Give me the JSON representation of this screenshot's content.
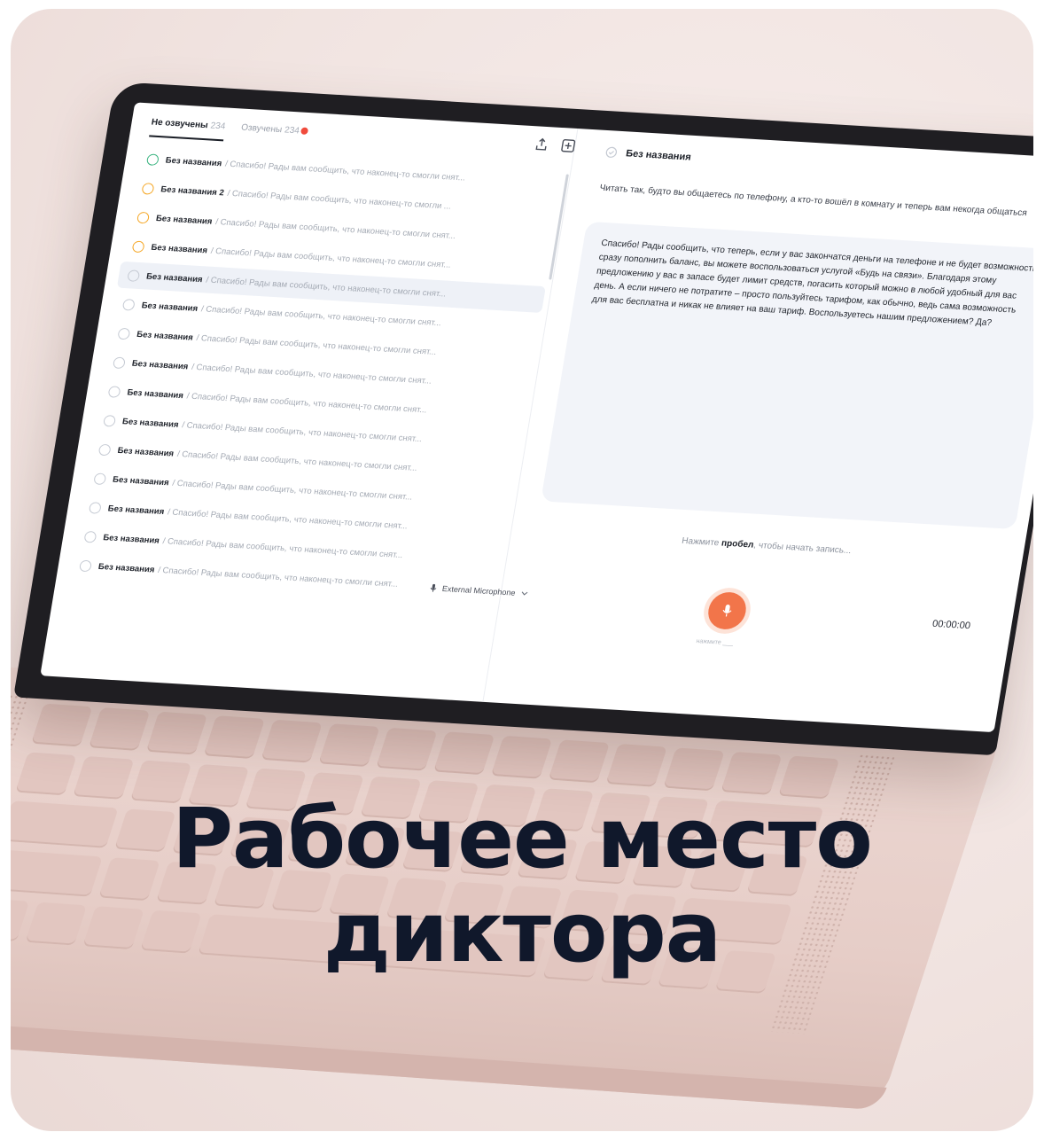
{
  "tabs": [
    {
      "label": "Не озвучены",
      "count": "234",
      "active": true
    },
    {
      "label": "Озвучены",
      "count": "234",
      "active": false
    }
  ],
  "toolbar": {
    "upload_icon": "upload-icon",
    "add_icon": "plus-square-icon"
  },
  "list": [
    {
      "title": "Без названия",
      "preview": "/ Спасибо! Рады вам сообщить, что наконец-то смогли снят...",
      "status": "done"
    },
    {
      "title": "Без названия 2",
      "preview": "/ Спасибо! Рады вам сообщить, что наконец-то смогли ...",
      "status": "wait"
    },
    {
      "title": "Без названия",
      "preview": "/ Спасибо! Рады вам сообщить, что наконец-то смогли снят...",
      "status": "wait"
    },
    {
      "title": "Без названия",
      "preview": "/ Спасибо! Рады вам сообщить, что наконец-то смогли снят...",
      "status": "wait"
    },
    {
      "title": "Без названия",
      "preview": "/ Спасибо! Рады вам сообщить, что наконец-то смогли снят...",
      "status": "none",
      "selected": true
    },
    {
      "title": "Без названия",
      "preview": "/ Спасибо! Рады вам сообщить, что наконец-то смогли снят...",
      "status": "none"
    },
    {
      "title": "Без названия",
      "preview": "/ Спасибо! Рады вам сообщить, что наконец-то смогли снят...",
      "status": "none"
    },
    {
      "title": "Без названия",
      "preview": "/ Спасибо! Рады вам сообщить, что наконец-то смогли снят...",
      "status": "none"
    },
    {
      "title": "Без названия",
      "preview": "/ Спасибо! Рады вам сообщить, что наконец-то смогли снят...",
      "status": "none"
    },
    {
      "title": "Без названия",
      "preview": "/ Спасибо! Рады вам сообщить, что наконец-то смогли снят...",
      "status": "none"
    },
    {
      "title": "Без названия",
      "preview": "/ Спасибо! Рады вам сообщить, что наконец-то смогли снят...",
      "status": "none"
    },
    {
      "title": "Без названия",
      "preview": "/ Спасибо! Рады вам сообщить, что наконец-то смогли снят...",
      "status": "none"
    },
    {
      "title": "Без названия",
      "preview": "/ Спасибо! Рады вам сообщить, что наконец-то смогли снят...",
      "status": "none"
    },
    {
      "title": "Без названия",
      "preview": "/ Спасибо! Рады вам сообщить, что наконец-то смогли снят...",
      "status": "none"
    },
    {
      "title": "Без названия",
      "preview": "/ Спасибо! Рады вам сообщить, что наконец-то смогли снят...",
      "status": "none"
    }
  ],
  "document": {
    "title": "Без названия",
    "instruction": "Читать так, будто вы общаетесь по телефону, а кто-то вошёл в комнату и теперь вам некогда общаться",
    "script": "Спасибо! Рады сообщить, что теперь, если у вас закончатся деньги на телефоне и не будет возможности сразу пополнить баланс, вы можете воспользоваться услугой «Будь на связи». Благодаря этому предложению у вас в запасе будет лимит средств, погасить который можно в любой удобный для вас день. А если ничего не потратите – просто пользуйтесь тарифом, как обычно, ведь сама возможность для вас бесплатна и никак не влияет на ваш тариф. Воспользуетесь нашим предложением? Да?"
  },
  "recorder": {
    "hint_before": "Нажмите",
    "hint_key": "пробел",
    "hint_after": ", чтобы начать запись...",
    "microphone": "External Microphone",
    "button_hint": "нажмите ___",
    "timer": "00:00:00",
    "accent": "#f2754a"
  },
  "headline": {
    "line1": "Рабочее место",
    "line2": "диктора"
  }
}
